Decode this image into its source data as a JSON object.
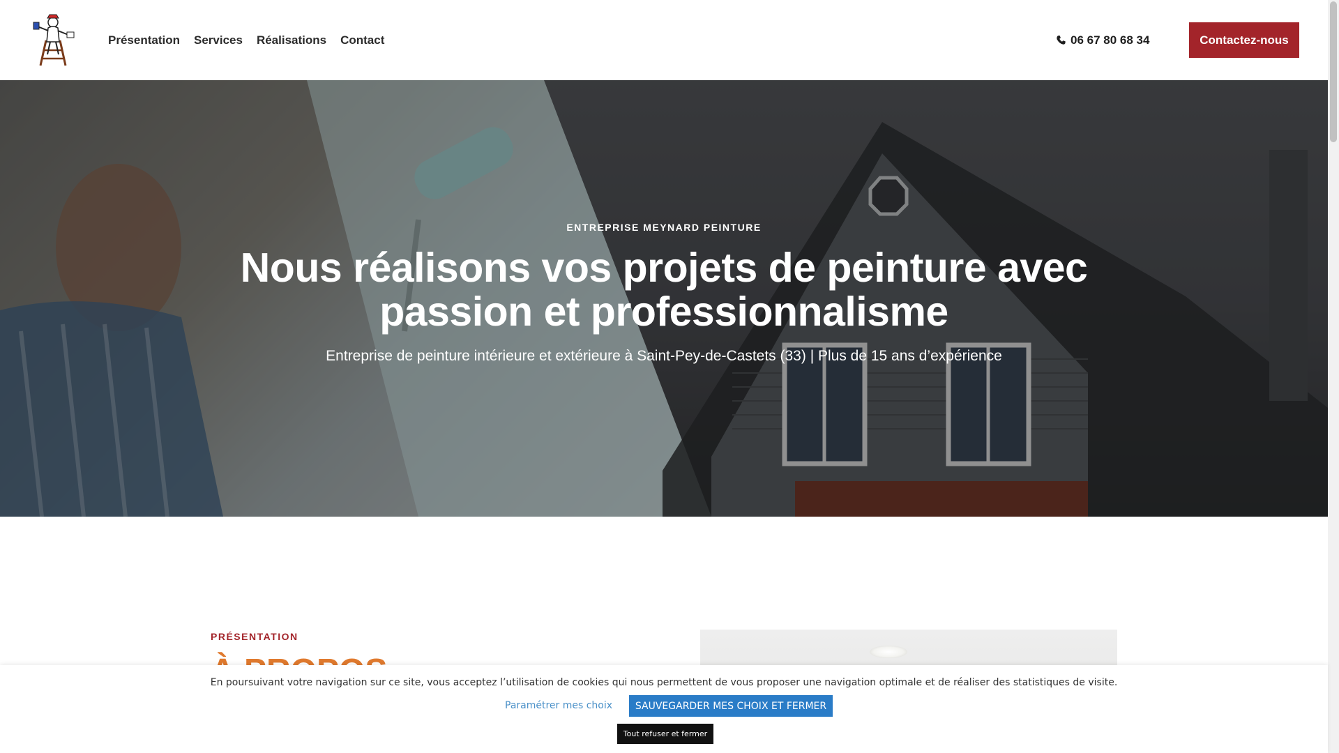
{
  "header": {
    "logo_name": "painter-logo",
    "nav": [
      {
        "label": "Présentation"
      },
      {
        "label": "Services"
      },
      {
        "label": "Réalisations"
      },
      {
        "label": "Contact"
      }
    ],
    "phone": "06 67 80 68 34",
    "phone_icon": "phone-icon",
    "cta_label": "Contactez-nous",
    "accent_color": "#a3242a"
  },
  "hero": {
    "eyebrow": "ENTREPRISE MEYNARD PEINTURE",
    "title": "Nous réalisons vos projets de peinture avec passion et professionnalisme",
    "subtitle": "Entreprise de peinture intérieure et extérieure à Saint-Pey-de-Castets (33) | Plus de 15 ans d’expérience"
  },
  "presentation": {
    "label": "PRÉSENTATION",
    "title": "À PROPOS",
    "title_color": "#e07a2e"
  },
  "cookie_banner": {
    "text": "En poursuivant votre navigation sur ce site, vous acceptez l’utilisation de cookies qui nous permettent de vous proposer une navigation optimale et de réaliser des statistiques de visite.",
    "settings_label": "Paramétrer mes choix",
    "save_label": "SAUVEGARDER MES CHOIX ET FERMER",
    "refuse_label": "Tout refuser et fermer",
    "save_color": "#2a7cc7"
  }
}
